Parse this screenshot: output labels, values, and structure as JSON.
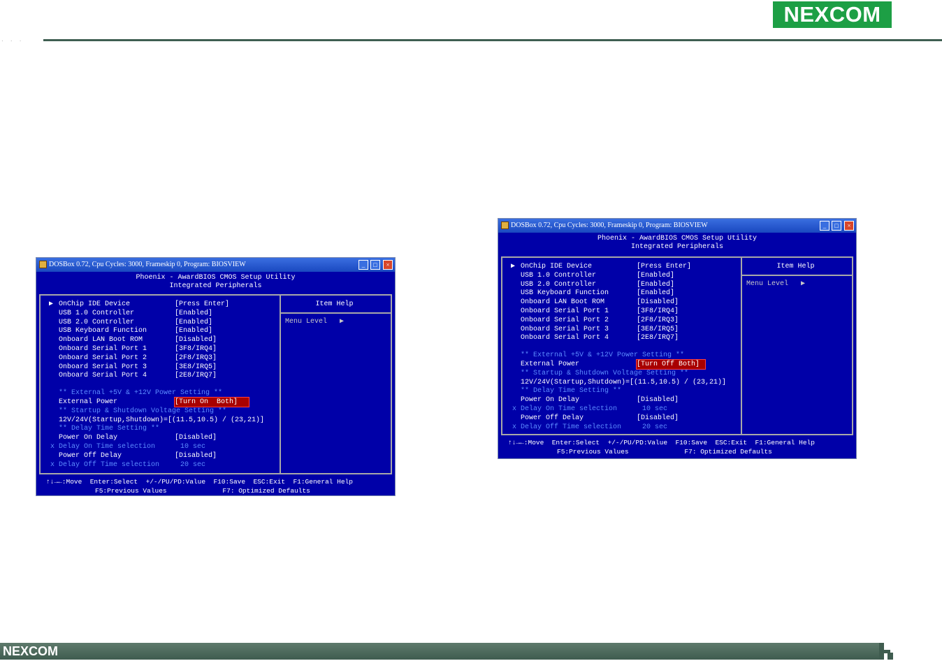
{
  "brand": {
    "logo_text": "NEXCOM",
    "footer_logo_text": "NEXCOM"
  },
  "colors": {
    "bios_bg": "#0000a8",
    "brand_green": "#1d9f45",
    "footer_bar": "#4a6a5c",
    "highlight": "#a80000"
  },
  "windows": [
    {
      "title": "DOSBox 0.72, Cpu Cycles:     3000, Frameskip  0, Program: BIOSVIEW",
      "header_line1": "Phoenix - AwardBIOS CMOS Setup Utility",
      "header_line2": "Integrated Peripherals",
      "items": [
        {
          "marker": "▶",
          "name": "OnChip IDE Device",
          "value": "[Press Enter]"
        },
        {
          "marker": "",
          "name": "USB 1.0 Controller",
          "value": "[Enabled]"
        },
        {
          "marker": "",
          "name": "USB 2.0 Controller",
          "value": "[Enabled]"
        },
        {
          "marker": "",
          "name": "USB Keyboard Function",
          "value": "[Enabled]"
        },
        {
          "marker": "",
          "name": "Onboard LAN Boot ROM",
          "value": "[Disabled]"
        },
        {
          "marker": "",
          "name": "Onboard Serial Port 1",
          "value": "[3F8/IRQ4]"
        },
        {
          "marker": "",
          "name": "Onboard Serial Port 2",
          "value": "[2F8/IRQ3]"
        },
        {
          "marker": "",
          "name": "Onboard Serial Port 3",
          "value": "[3E8/IRQ5]"
        },
        {
          "marker": "",
          "name": "Onboard Serial Port 4",
          "value": "[2E8/IRQ7]"
        }
      ],
      "section_power": "** External +5V & +12V Power Setting **",
      "external_power_label": "External Power",
      "external_power_value": "[Turn On  Both]",
      "section_startup": "** Startup & Shutdown Voltage Setting **",
      "voltage_line": "12V/24V(Startup,Shutdown)=[(11.5,10.5) / (23,21)]",
      "section_delay": "** Delay Time Setting **",
      "power_on_delay_label": "Power On Delay",
      "power_on_delay_value": "[Disabled]",
      "delay_on_label": "x Delay On Time selection",
      "delay_on_value": "10 sec",
      "power_off_delay_label": "Power Off Delay",
      "power_off_delay_value": "[Disabled]",
      "delay_off_label": "x Delay Off Time selection",
      "delay_off_value": "20 sec",
      "help_title": "Item Help",
      "help_menu_level": "Menu Level   ▶",
      "footer_line1": "↑↓→←:Move  Enter:Select  +/-/PU/PD:Value  F10:Save  ESC:Exit  F1:General Help",
      "footer_line2": "F5:Previous Values              F7: Optimized Defaults"
    },
    {
      "title": "DOSBox 0.72, Cpu Cycles:     3000, Frameskip  0, Program: BIOSVIEW",
      "header_line1": "Phoenix - AwardBIOS CMOS Setup Utility",
      "header_line2": "Integrated Peripherals",
      "items": [
        {
          "marker": "▶",
          "name": "OnChip IDE Device",
          "value": "[Press Enter]"
        },
        {
          "marker": "",
          "name": "USB 1.0 Controller",
          "value": "[Enabled]"
        },
        {
          "marker": "",
          "name": "USB 2.0 Controller",
          "value": "[Enabled]"
        },
        {
          "marker": "",
          "name": "USB Keyboard Function",
          "value": "[Enabled]"
        },
        {
          "marker": "",
          "name": "Onboard LAN Boot ROM",
          "value": "[Disabled]"
        },
        {
          "marker": "",
          "name": "Onboard Serial Port 1",
          "value": "[3F8/IRQ4]"
        },
        {
          "marker": "",
          "name": "Onboard Serial Port 2",
          "value": "[2F8/IRQ3]"
        },
        {
          "marker": "",
          "name": "Onboard Serial Port 3",
          "value": "[3E8/IRQ5]"
        },
        {
          "marker": "",
          "name": "Onboard Serial Port 4",
          "value": "[2E8/IRQ7]"
        }
      ],
      "section_power": "** External +5V & +12V Power Setting **",
      "external_power_label": "External Power",
      "external_power_value": "[Turn Off Both]",
      "section_startup": "** Startup & Shutdown Voltage Setting **",
      "voltage_line": "12V/24V(Startup,Shutdown)=[(11.5,10.5) / (23,21)]",
      "section_delay": "** Delay Time Setting **",
      "power_on_delay_label": "Power On Delay",
      "power_on_delay_value": "[Disabled]",
      "delay_on_label": "x Delay On Time selection",
      "delay_on_value": "10 sec",
      "power_off_delay_label": "Power Off Delay",
      "power_off_delay_value": "[Disabled]",
      "delay_off_label": "x Delay Off Time selection",
      "delay_off_value": "20 sec",
      "help_title": "Item Help",
      "help_menu_level": "Menu Level   ▶",
      "footer_line1": "↑↓→←:Move  Enter:Select  +/-/PU/PD:Value  F10:Save  ESC:Exit  F1:General Help",
      "footer_line2": "F5:Previous Values              F7: Optimized Defaults"
    }
  ]
}
